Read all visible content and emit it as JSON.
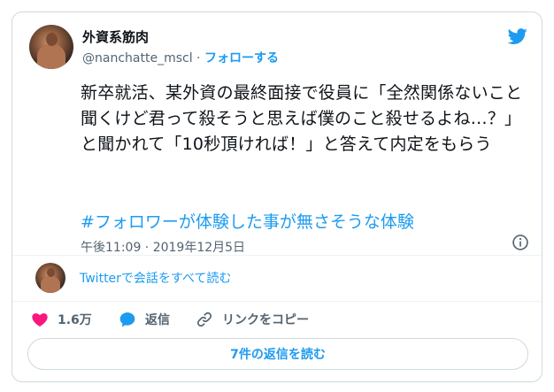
{
  "author": {
    "name": "外資系筋肉",
    "handle": "@nanchatte_mscl",
    "separator": "·",
    "follow_label": "フォローする"
  },
  "tweet": {
    "text": "新卒就活、某外資の最終面接で役員に「全然関係ないこと聞くけど君って殺そうと思えば僕のこと殺せるよね…？」と聞かれて「10秒頂ければ！」と答えて内定をもらう",
    "hashtag": "#フォロワーが体験した事が無さそうな体験",
    "timestamp": "午後11:09 · 2019年12月5日"
  },
  "conversation": {
    "read_all_label": "Twitterで会話をすべて読む"
  },
  "actions": {
    "like_count": "1.6万",
    "reply_label": "返信",
    "copy_link_label": "リンクをコピー"
  },
  "replies_button_label": "7件の返信を読む",
  "colors": {
    "accent": "#1d9bf0",
    "like": "#f91880",
    "muted": "#536471",
    "border": "#cfd9de"
  },
  "icons": [
    "twitter-bird-icon",
    "info-icon",
    "heart-icon",
    "reply-bubble-icon",
    "link-icon"
  ]
}
